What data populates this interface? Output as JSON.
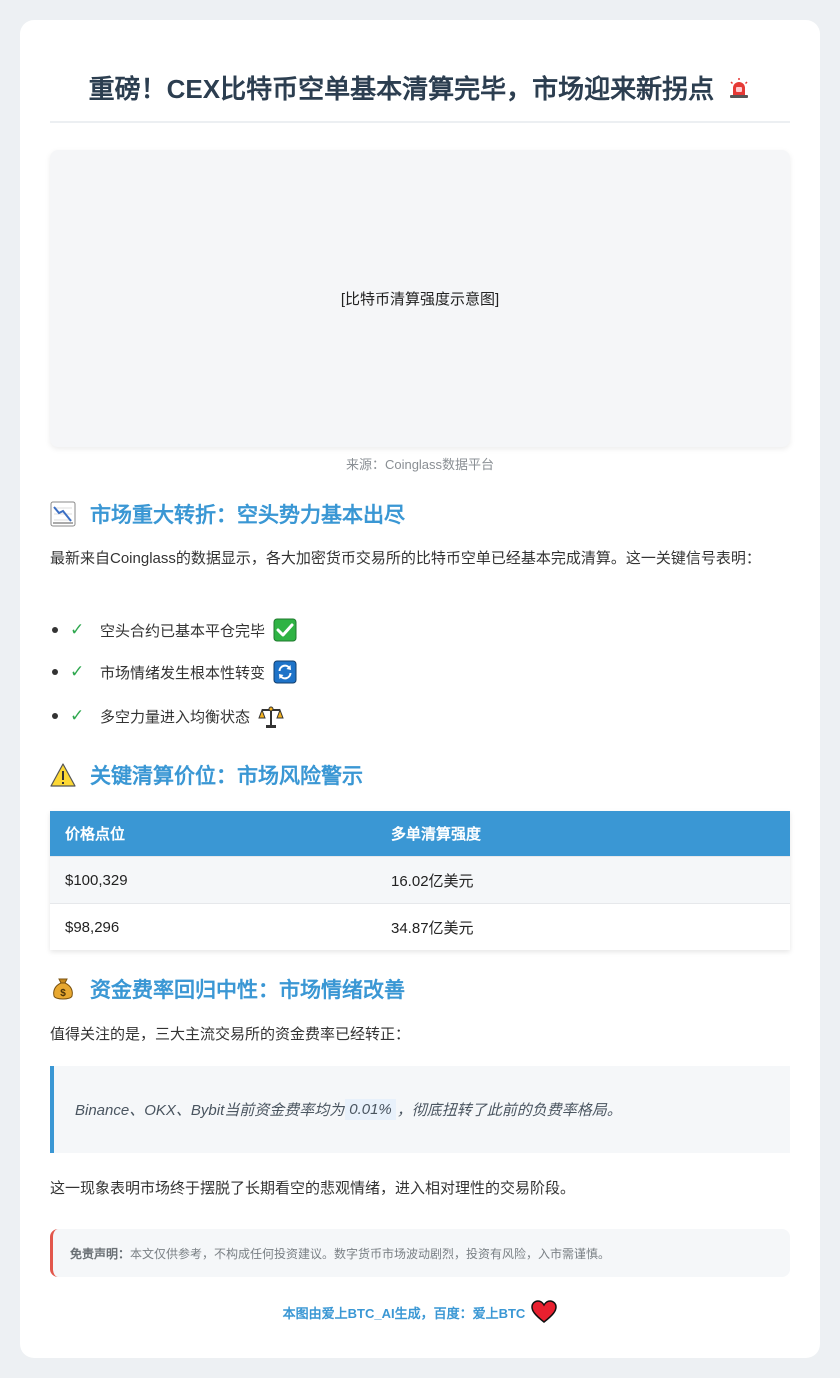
{
  "title": "重磅！CEX比特币空单基本清算完毕，市场迎来新拐点",
  "hero": {
    "placeholder": "[比特币清算强度示意图]",
    "caption": "来源：Coinglass数据平台"
  },
  "section1": {
    "icon": "chart-decreasing-icon",
    "heading": "市场重大转折：空头势力基本出尽",
    "intro": "最新来自Coinglass的数据显示，各大加密货币交易所的比特币空单已经基本完成清算。这一关键信号表明：",
    "bullets": [
      {
        "text": "空头合约已基本平仓完毕",
        "emoji": "check-box-icon"
      },
      {
        "text": "市场情绪发生根本性转变",
        "emoji": "refresh-icon"
      },
      {
        "text": "多空力量进入均衡状态",
        "emoji": "balance-scale-icon"
      }
    ],
    "check_mark": "✓"
  },
  "section2": {
    "icon": "warning-icon",
    "heading": "关键清算价位：市场风险警示",
    "table": {
      "headers": [
        "价格点位",
        "多单清算强度"
      ],
      "rows": [
        [
          "$100,329",
          "16.02亿美元"
        ],
        [
          "$98,296",
          "34.87亿美元"
        ]
      ]
    }
  },
  "section3": {
    "icon": "money-bag-icon",
    "heading": "资金费率回归中性：市场情绪改善",
    "intro": "值得关注的是，三大主流交易所的资金费率已经转正：",
    "quote_before": "Binance、OKX、Bybit当前资金费率均为",
    "quote_highlight": "0.01%",
    "quote_after": "，彻底扭转了此前的负费率格局。",
    "conclusion": "这一现象表明市场终于摆脱了长期看空的悲观情绪，进入相对理性的交易阶段。"
  },
  "disclaimer": {
    "label": "免责声明：",
    "text": "本文仅供参考，不构成任何投资建议。数字货币市场波动剧烈，投资有风险，入市需谨慎。"
  },
  "footer": {
    "text": "本图由爱上BTC_AI生成，百度：爱上BTC"
  },
  "colors": {
    "accent": "#3a97d4",
    "title": "#2c3e50",
    "check": "#2fa84f",
    "disclaimer_border": "#e2574c"
  }
}
